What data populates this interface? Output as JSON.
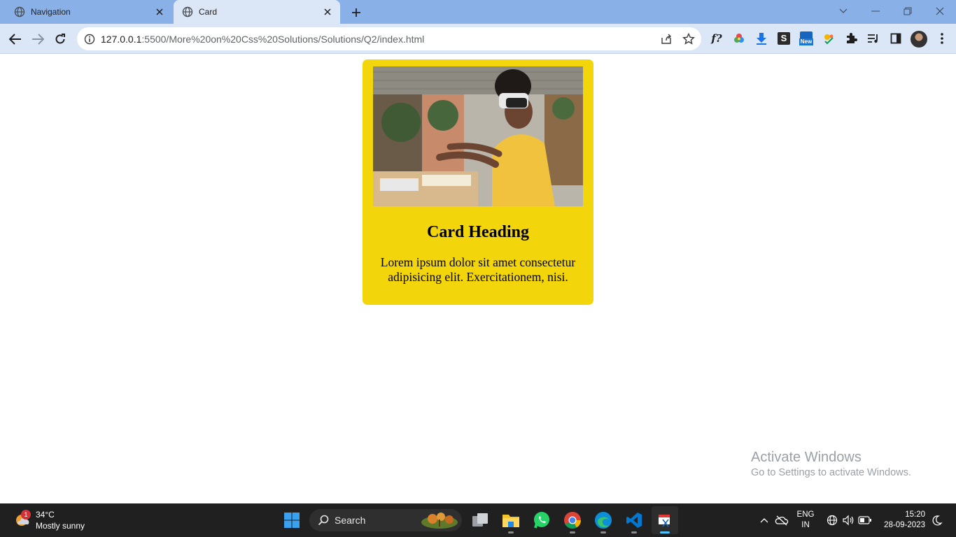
{
  "browser": {
    "tabs": [
      {
        "title": "Navigation",
        "active": false
      },
      {
        "title": "Card",
        "active": true
      }
    ],
    "address": {
      "host": "127.0.0.1",
      "path": ":5500/More%20on%20Css%20Solutions/Solutions/Q2/index.html"
    },
    "extensions": [
      "formula-icon",
      "color-wheel-icon",
      "download-arrow-icon",
      "s-extension-icon",
      "new-badge-extension-icon",
      "multicolor-extension-icon",
      "puzzle-icon",
      "reading-list-icon",
      "side-panel-icon"
    ],
    "extension_badge_text": "New",
    "s_extension_letter": "S",
    "formula_label": "f?"
  },
  "card": {
    "heading": "Card Heading",
    "text": "Lorem ipsum dolor sit amet consectetur adipisicing elit. Exercitationem, nisi.",
    "image_description_icon": "vr-person-photo",
    "background_color": "#f2d60b"
  },
  "watermark": {
    "line1": "Activate Windows",
    "line2": "Go to Settings to activate Windows."
  },
  "taskbar": {
    "weather": {
      "temp": "34°C",
      "condition": "Mostly sunny",
      "badge": "1"
    },
    "search_label": "Search",
    "lang": {
      "line1": "ENG",
      "line2": "IN"
    },
    "clock": {
      "time": "15:20",
      "date": "28-09-2023"
    }
  }
}
